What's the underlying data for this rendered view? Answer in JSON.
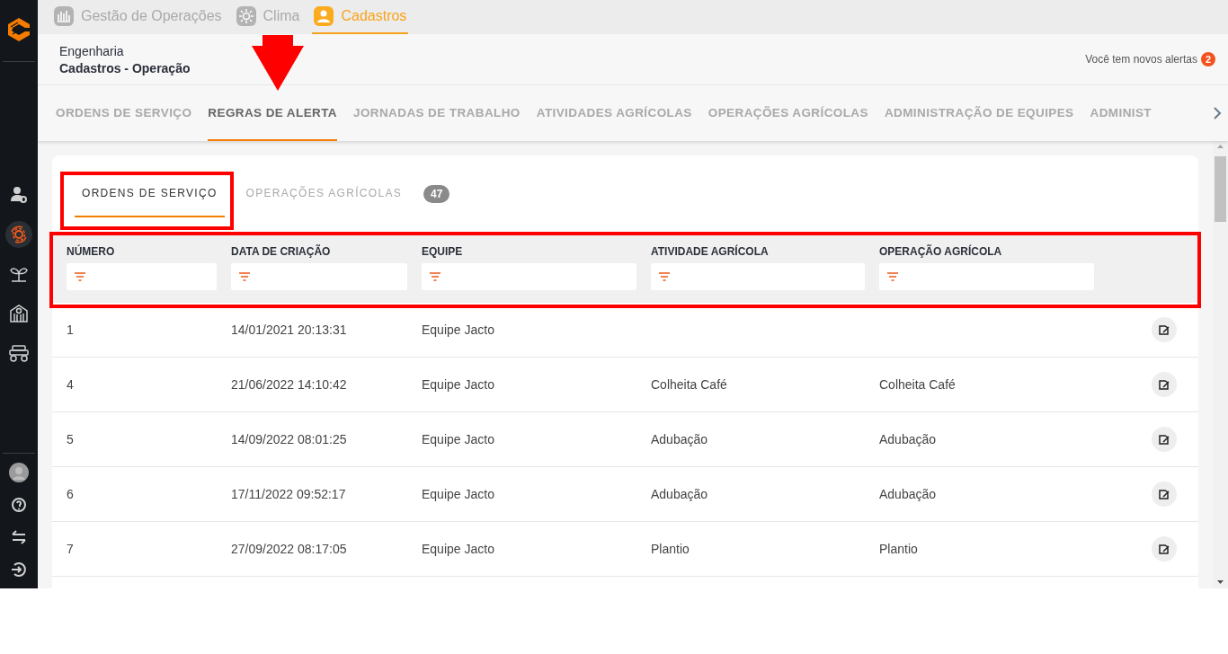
{
  "sidebar": {
    "items": [
      {
        "kind": "user-settings",
        "selected": false
      },
      {
        "kind": "gear-cycle",
        "selected": true
      },
      {
        "kind": "sprout",
        "selected": false
      },
      {
        "kind": "barn",
        "selected": false
      },
      {
        "kind": "vehicle",
        "selected": false
      }
    ],
    "footer": [
      {
        "kind": "avatar"
      },
      {
        "kind": "help"
      },
      {
        "kind": "swap"
      },
      {
        "kind": "logout"
      }
    ]
  },
  "top_tabs": [
    {
      "label": "Gestão de Operações",
      "kind": "chart",
      "selected": false
    },
    {
      "label": "Clima",
      "kind": "sun",
      "selected": false
    },
    {
      "label": "Cadastros",
      "kind": "user",
      "selected": true
    }
  ],
  "breadcrumb": {
    "section": "Engenharia",
    "page": "Cadastros - Operação"
  },
  "alerts": {
    "text": "Você tem novos alertas",
    "count": "2"
  },
  "nav_tabs": [
    {
      "label": "ORDENS DE SERVIÇO",
      "selected": false
    },
    {
      "label": "REGRAS DE ALERTA",
      "selected": true
    },
    {
      "label": "JORNADAS DE TRABALHO",
      "selected": false
    },
    {
      "label": "ATIVIDADES AGRÍCOLAS",
      "selected": false
    },
    {
      "label": "OPERAÇÕES AGRÍCOLAS",
      "selected": false
    },
    {
      "label": "ADMINISTRAÇÃO DE EQUIPES",
      "selected": false
    },
    {
      "label": "ADMINIST",
      "selected": false
    }
  ],
  "inner_tabs": [
    {
      "label": "ORDENS DE SERVIÇO",
      "selected": true
    },
    {
      "label": "OPERAÇÕES AGRÍCOLAS",
      "selected": false
    }
  ],
  "count_badge": "47",
  "table": {
    "columns": [
      {
        "label": "NÚMERO"
      },
      {
        "label": "DATA DE CRIAÇÃO"
      },
      {
        "label": "EQUIPE"
      },
      {
        "label": "ATIVIDADE AGRÍCOLA"
      },
      {
        "label": "OPERAÇÃO AGRÍCOLA"
      }
    ],
    "rows": [
      {
        "cells": [
          "1",
          "14/01/2021 20:13:31",
          "Equipe Jacto",
          "",
          ""
        ]
      },
      {
        "cells": [
          "4",
          "21/06/2022 14:10:42",
          "Equipe Jacto",
          "Colheita Café",
          "Colheita Café"
        ]
      },
      {
        "cells": [
          "5",
          "14/09/2022 08:01:25",
          "Equipe Jacto",
          "Adubação",
          "Adubação"
        ]
      },
      {
        "cells": [
          "6",
          "17/11/2022 09:52:17",
          "Equipe Jacto",
          "Adubação",
          "Adubação"
        ]
      },
      {
        "cells": [
          "7",
          "27/09/2022 08:17:05",
          "Equipe Jacto",
          "Plantio",
          "Plantio"
        ]
      }
    ]
  }
}
